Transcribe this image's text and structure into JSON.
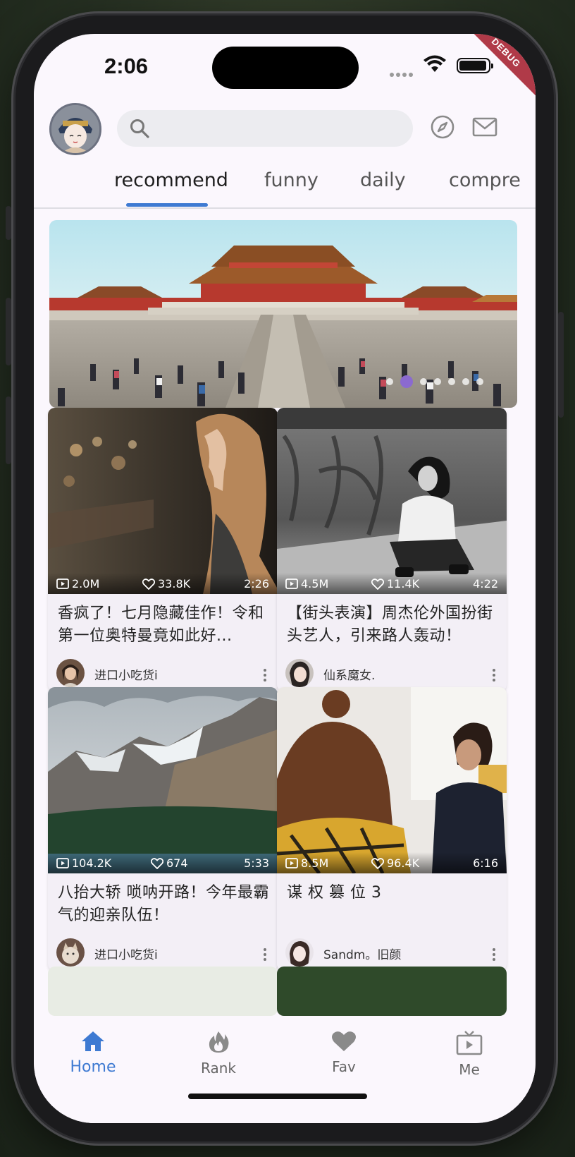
{
  "status_bar": {
    "time": "2:06",
    "debug_label": "DEBUG"
  },
  "header": {
    "avatar": "avatar",
    "search_icon": "search-icon",
    "explore_icon": "compass-icon",
    "mail_icon": "mail-icon"
  },
  "tabs": [
    {
      "label": "recommend",
      "active": true
    },
    {
      "label": "funny",
      "active": false
    },
    {
      "label": "daily",
      "active": false
    },
    {
      "label": "compre",
      "active": false
    }
  ],
  "banner": {
    "page_count": 7,
    "current_page": 2
  },
  "feed": [
    {
      "views": "2.0M",
      "likes": "33.8K",
      "duration": "2:26",
      "title": "香疯了！七月隐藏佳作！令和第一位奥特曼竟如此好...",
      "owner": "进口小吃货i"
    },
    {
      "views": "4.5M",
      "likes": "11.4K",
      "duration": "4:22",
      "title": "【街头表演】周杰伦外国扮街头艺人，引来路人轰动！",
      "owner": "仙系魔女."
    },
    {
      "views": "104.2K",
      "likes": "674",
      "duration": "5:33",
      "title": "八抬大轿 唢呐开路！今年最霸气的迎亲队伍！",
      "owner": "进口小吃货i"
    },
    {
      "views": "8.5M",
      "likes": "96.4K",
      "duration": "6:16",
      "title": "谋 权 篡 位 3",
      "owner": "Sandm。旧颜"
    }
  ],
  "bottom_nav": [
    {
      "label": "Home",
      "icon": "home-icon",
      "active": true
    },
    {
      "label": "Rank",
      "icon": "fire-icon",
      "active": false
    },
    {
      "label": "Fav",
      "icon": "heart-icon",
      "active": false
    },
    {
      "label": "Me",
      "icon": "tv-icon",
      "active": false
    }
  ],
  "colors": {
    "accent": "#3e7ad2",
    "pager_active": "#8b6ad0",
    "background": "#fbf7fd",
    "card": "#f3eff6"
  }
}
